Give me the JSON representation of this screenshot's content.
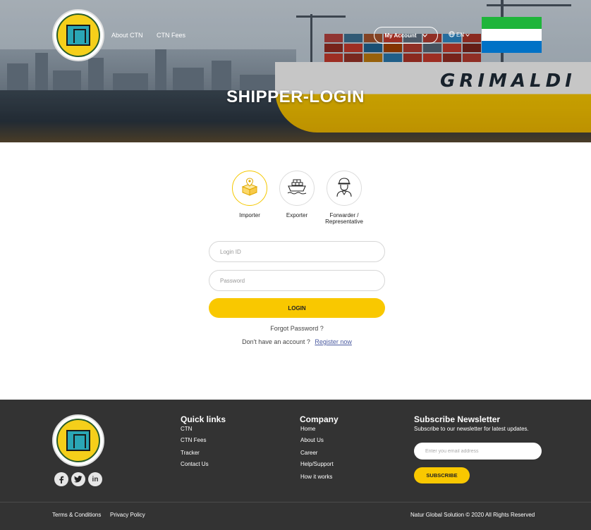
{
  "header": {
    "nav": [
      "About CTN",
      "CTN Fees"
    ],
    "my_account": "My Account",
    "language": "EN",
    "title": "SHIPPER-LOGIN",
    "ship_name": "GRIMALDI",
    "flag_colors": [
      "#1eb53a",
      "#ffffff",
      "#0072c6"
    ]
  },
  "roles": [
    {
      "label": "Importer",
      "icon": "map-box-icon",
      "selected": true
    },
    {
      "label": "Exporter",
      "icon": "cargo-ship-icon",
      "selected": false
    },
    {
      "label": "Forwarder / Representative",
      "label_line1": "Forwarder /",
      "label_line2": "Representative",
      "icon": "worker-icon",
      "selected": false
    }
  ],
  "form": {
    "login_id_placeholder": "Login ID",
    "password_placeholder": "Password",
    "login_button": "LOGIN",
    "forgot_password": "Forgot Password ?",
    "no_account_text": "Don't have an account ?",
    "register_link": "Register now"
  },
  "footer": {
    "quick_links": {
      "title": "Quick links",
      "items": [
        "CTN",
        "CTN Fees",
        "Tracker",
        "Contact Us"
      ]
    },
    "company": {
      "title": "Company",
      "items": [
        "Home",
        "About Us",
        "Career",
        "Help/Support",
        "How it works"
      ]
    },
    "newsletter": {
      "title": "Subscribe Newsletter",
      "description": "Subscribe to our newsletter for latest updates.",
      "email_placeholder": "Enter you email address",
      "button": "SUBSCRIBE"
    },
    "social": [
      "facebook-icon",
      "twitter-icon",
      "linkedin-icon"
    ],
    "bottom_links": [
      "Terms & Conditions",
      "Privacy Policy"
    ],
    "copyright": "Natur Global Solution © 2020 All Rights Reserved"
  },
  "colors": {
    "accent": "#f9c800",
    "footer_bg": "#333333"
  }
}
